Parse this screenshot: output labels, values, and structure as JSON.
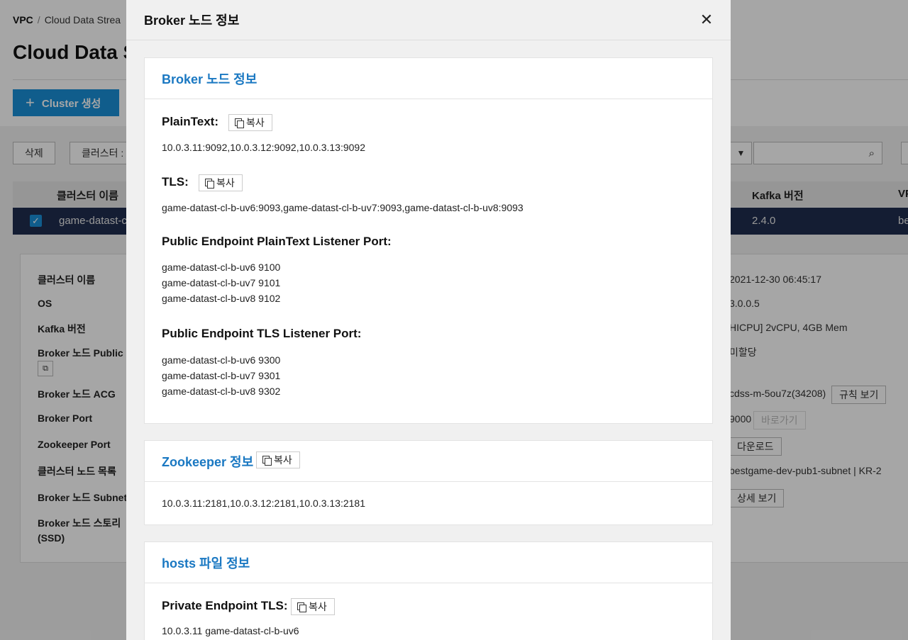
{
  "background": {
    "breadcrumb": {
      "root": "VPC",
      "sep": "/",
      "current": "Cloud Data Strea"
    },
    "page_title": "Cloud Data S",
    "create_button": "Cluster 생성",
    "toolbar": {
      "delete": "삭제",
      "cluster_menu": "클러스터 :"
    },
    "table": {
      "headers": {
        "name": "클러스터 이름",
        "kafka_version": "Kafka 버전",
        "vpc": "VP"
      },
      "selected_row": {
        "name": "game-datast-c",
        "kafka_version": "2.4.0",
        "vpc": "be"
      }
    },
    "details": {
      "labels": [
        "클러스터 이름",
        "OS",
        "Kafka 버전",
        "Broker 노드 Public",
        "Broker 노드 ACG",
        "Broker Port",
        "Zookeeper Port",
        "클러스터 노드 목록",
        "Broker 노드 Subnet",
        "Broker 노드 스토리",
        "(SSD)"
      ],
      "values": [
        "2021-12-30 06:45:17",
        "3.0.0.5",
        "HICPU] 2vCPU, 4GB Mem",
        "미할당",
        "cdss-m-5ou7z(34208)",
        "9000",
        "bestgame-dev-pub1-subnet | KR-2"
      ],
      "buttons": {
        "rules": "규칙 보기",
        "goto": "바로가기",
        "download": "다운로드",
        "detail": "상세 보기"
      }
    }
  },
  "modal": {
    "title": "Broker 노드 정보",
    "copy_label": "복사",
    "broker_card": {
      "title": "Broker 노드 정보",
      "plaintext_label": "PlainText:",
      "plaintext_value": "10.0.3.11:9092,10.0.3.12:9092,10.0.3.13:9092",
      "tls_label": "TLS:",
      "tls_value": "game-datast-cl-b-uv6:9093,game-datast-cl-b-uv7:9093,game-datast-cl-b-uv8:9093",
      "public_plain_label": "Public Endpoint PlainText Listener Port:",
      "public_plain_lines": [
        "game-datast-cl-b-uv6 9100",
        "game-datast-cl-b-uv7 9101",
        "game-datast-cl-b-uv8 9102"
      ],
      "public_tls_label": "Public Endpoint TLS Listener Port:",
      "public_tls_lines": [
        "game-datast-cl-b-uv6 9300",
        "game-datast-cl-b-uv7 9301",
        "game-datast-cl-b-uv8 9302"
      ]
    },
    "zookeeper_card": {
      "title": "Zookeeper 정보",
      "value": "10.0.3.11:2181,10.0.3.12:2181,10.0.3.13:2181"
    },
    "hosts_card": {
      "title": "hosts 파일 정보",
      "private_tls_label": "Private Endpoint TLS:",
      "first_line": "10.0.3.11 game-datast-cl-b-uv6"
    }
  }
}
